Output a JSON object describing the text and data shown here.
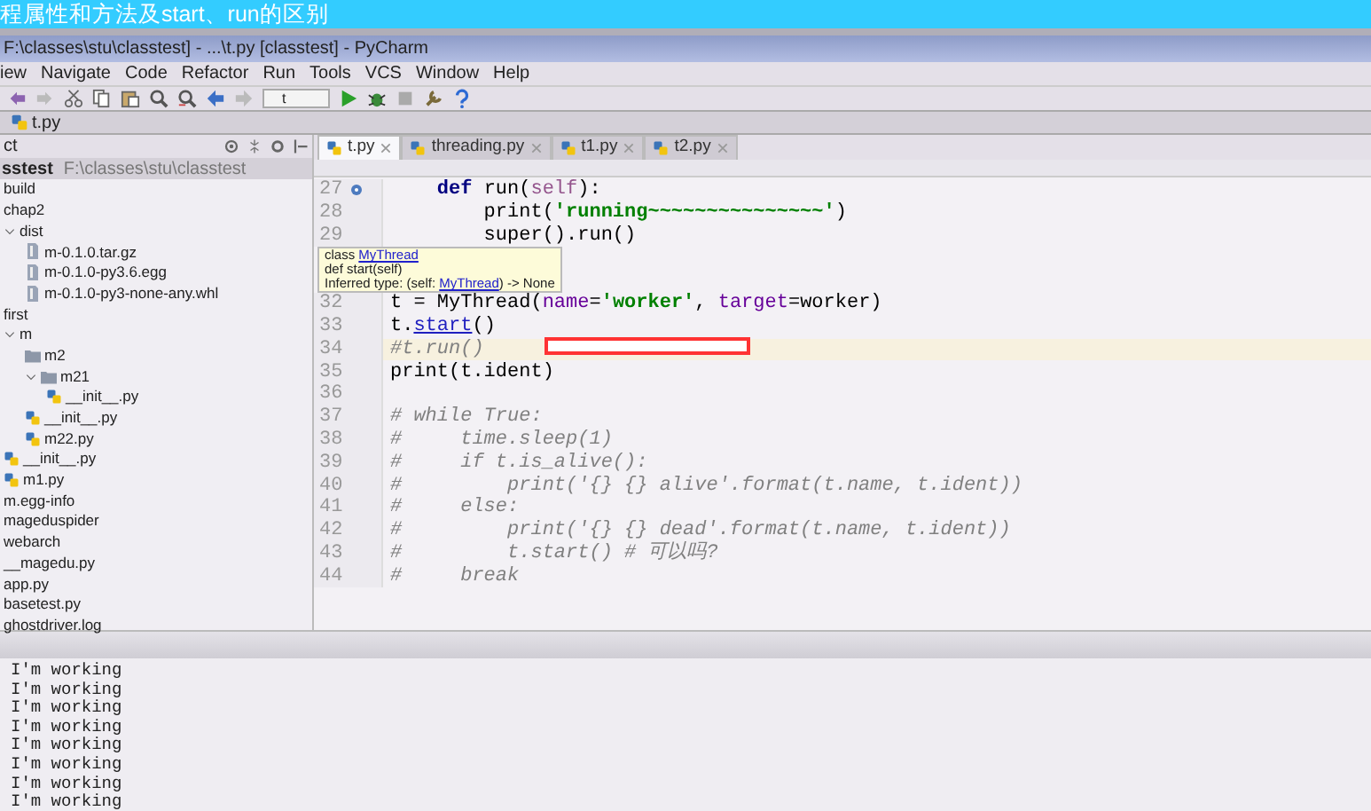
{
  "banner": {
    "title": "程属性和方法及start、run的区别"
  },
  "window": {
    "title": "F:\\classes\\stu\\classtest] - ...\\t.py [classtest] - PyCharm"
  },
  "menu": [
    "iew",
    "Navigate",
    "Code",
    "Refactor",
    "Run",
    "Tools",
    "VCS",
    "Window",
    "Help"
  ],
  "toolbar": {
    "run_config": "t"
  },
  "breadcrumb": "t.py",
  "project": {
    "view": "ct",
    "root": {
      "name": "sstest",
      "path": "F:\\classes\\stu\\classtest"
    },
    "tree": [
      {
        "name": "build",
        "kind": "folder"
      },
      {
        "name": "chap2",
        "kind": "folder"
      },
      {
        "name": "dist",
        "kind": "folder",
        "expanded": true,
        "children": [
          {
            "name": "m-0.1.0.tar.gz",
            "kind": "archive"
          },
          {
            "name": "m-0.1.0-py3.6.egg",
            "kind": "archive"
          },
          {
            "name": "m-0.1.0-py3-none-any.whl",
            "kind": "archive"
          }
        ]
      },
      {
        "name": "first",
        "kind": "folder"
      },
      {
        "name": "m",
        "kind": "folder",
        "expanded": true,
        "children": [
          {
            "name": "m2",
            "kind": "folder"
          },
          {
            "name": "m21",
            "kind": "folder",
            "expanded": true,
            "children": [
              {
                "name": "__init__.py",
                "kind": "python"
              }
            ]
          },
          {
            "name": "__init__.py",
            "kind": "python"
          },
          {
            "name": "m22.py",
            "kind": "python"
          }
        ]
      },
      {
        "name": "__init__.py",
        "kind": "python"
      },
      {
        "name": "m1.py",
        "kind": "python"
      },
      {
        "name": "m.egg-info",
        "kind": "folder"
      },
      {
        "name": "mageduspider",
        "kind": "folder"
      },
      {
        "name": "webarch",
        "kind": "folder"
      },
      {
        "name": "__magedu.py",
        "kind": "folder"
      },
      {
        "name": "app.py",
        "kind": "folder"
      },
      {
        "name": "basetest.py",
        "kind": "folder"
      },
      {
        "name": "ghostdriver.log",
        "kind": "folder"
      }
    ]
  },
  "tabs": [
    {
      "label": "t.py",
      "selected": true
    },
    {
      "label": "threading.py",
      "selected": false
    },
    {
      "label": "t1.py",
      "selected": false
    },
    {
      "label": "t2.py",
      "selected": false
    }
  ],
  "code": [
    {
      "kind": "line",
      "number": "27",
      "marker": true,
      "tokens": [
        {
          "kind": "kw",
          "text": "    def"
        },
        {
          "kind": "plain",
          "text": " run("
        },
        {
          "kind": "self",
          "text": "self"
        },
        {
          "kind": "plain",
          "text": "):"
        }
      ]
    },
    {
      "kind": "line",
      "number": "28",
      "tokens": [
        {
          "kind": "plain",
          "text": "        print("
        },
        {
          "kind": "str",
          "text": "'running~~~~~~~~~~~~~~~'"
        },
        {
          "kind": "plain",
          "text": ")"
        }
      ]
    },
    {
      "kind": "line",
      "number": "29",
      "tokens": [
        {
          "kind": "plain",
          "text": "        super().run()"
        }
      ]
    },
    {
      "kind": "tooltip",
      "lines": [
        [
          {
            "text": "class "
          },
          {
            "text": "MyThread",
            "link": true
          }
        ],
        [
          {
            "text": "def start(self)"
          }
        ],
        [
          {
            "text": "Inferred type: (self: "
          },
          {
            "text": "MyThread",
            "link": true
          },
          {
            "text": ") -> None"
          }
        ]
      ]
    },
    {
      "kind": "line",
      "number": "32",
      "tokens": [
        {
          "kind": "plain",
          "text": "t = MyThread("
        },
        {
          "kind": "param",
          "text": "name"
        },
        {
          "kind": "plain",
          "text": "="
        },
        {
          "kind": "str",
          "text": "'worker'"
        },
        {
          "kind": "plain",
          "text": ", "
        },
        {
          "kind": "param",
          "text": "target"
        },
        {
          "kind": "plain",
          "text": "=worker)"
        }
      ]
    },
    {
      "kind": "line",
      "number": "33",
      "tokens": [
        {
          "kind": "plain",
          "text": "t."
        },
        {
          "kind": "link",
          "text": "start"
        },
        {
          "kind": "plain",
          "text": "()"
        }
      ]
    },
    {
      "kind": "line",
      "number": "34",
      "current": true,
      "tokens": [
        {
          "kind": "comment",
          "text": "#t.run()"
        }
      ]
    },
    {
      "kind": "line",
      "number": "35",
      "tokens": [
        {
          "kind": "plain",
          "text": "print(t.ident)"
        }
      ]
    },
    {
      "kind": "line",
      "number": "36"
    },
    {
      "kind": "line",
      "number": "37",
      "tokens": [
        {
          "kind": "comment",
          "text": "# while True:"
        }
      ]
    },
    {
      "kind": "line",
      "number": "38",
      "tokens": [
        {
          "kind": "comment",
          "text": "#     time.sleep(1)"
        }
      ]
    },
    {
      "kind": "line",
      "number": "39",
      "tokens": [
        {
          "kind": "comment",
          "text": "#     if t.is_alive():"
        }
      ]
    },
    {
      "kind": "line",
      "number": "40",
      "tokens": [
        {
          "kind": "comment",
          "text": "#         print('{} {} alive'.format(t.name, t.ident))"
        }
      ]
    },
    {
      "kind": "line",
      "number": "41",
      "tokens": [
        {
          "kind": "comment",
          "text": "#     else:"
        }
      ]
    },
    {
      "kind": "line",
      "number": "42",
      "tokens": [
        {
          "kind": "comment",
          "text": "#         print('{} {} dead'.format(t.name, t.ident))"
        }
      ]
    },
    {
      "kind": "line",
      "number": "43",
      "tokens": [
        {
          "kind": "comment",
          "text": "#         t.start() # 可以吗?"
        }
      ]
    },
    {
      "kind": "line",
      "number": "44",
      "tokens": [
        {
          "kind": "comment",
          "text": "#     break"
        }
      ]
    }
  ],
  "console": [
    "I'm working",
    "I'm working",
    "I'm working",
    "I'm working",
    "I'm working",
    "I'm working",
    "I'm working",
    "I'm working"
  ]
}
